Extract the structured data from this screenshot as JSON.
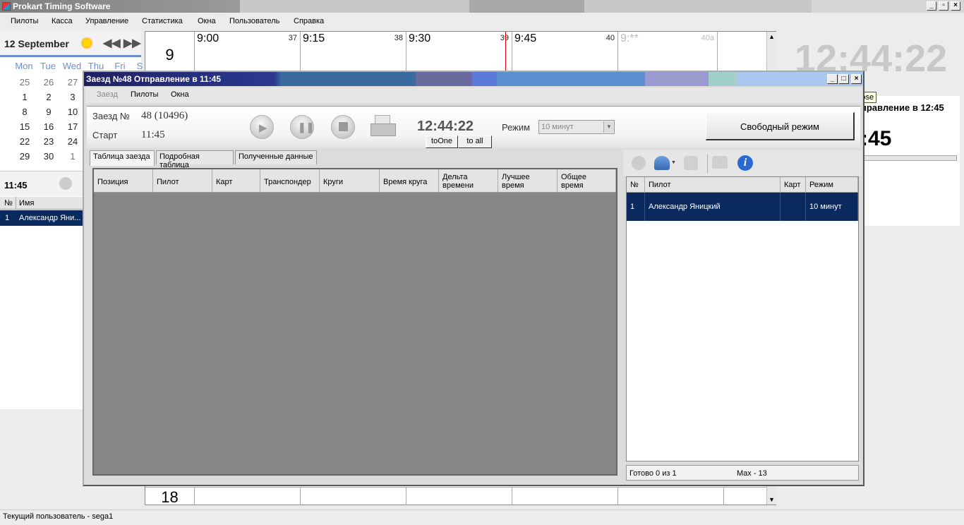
{
  "app": {
    "title": "Prokart Timing Software"
  },
  "menu": [
    "Пилоты",
    "Касса",
    "Управление",
    "Статистика",
    "Окна",
    "Пользователь",
    "Справка"
  ],
  "left": {
    "date": "12 September",
    "weekdays": [
      "Mon",
      "Tue",
      "Wed",
      "Thu",
      "Fri",
      "S"
    ],
    "weeks": [
      [
        "25",
        "26",
        "27"
      ],
      [
        "1",
        "2",
        "3"
      ],
      [
        "8",
        "9",
        "10"
      ],
      [
        "15",
        "16",
        "17"
      ],
      [
        "22",
        "23",
        "24"
      ],
      [
        "29",
        "30",
        "1"
      ]
    ],
    "heat_time": "11:45",
    "col_num": "№",
    "col_name": "Имя",
    "row_num": "1",
    "row_name": "Александр Яни..."
  },
  "schedule": {
    "hour": "9",
    "slots": [
      {
        "time": "9:00",
        "num": "37"
      },
      {
        "time": "9:15",
        "num": "38"
      },
      {
        "time": "9:30",
        "num": "39"
      },
      {
        "time": "9:45",
        "num": "40"
      },
      {
        "time": "9:**",
        "num": "40a"
      }
    ],
    "bottom_hour": "18"
  },
  "right": {
    "clock": "12:44:22",
    "depart": "правление в 12:45",
    "time": ":45"
  },
  "tooltip": "Close",
  "dialog": {
    "title": "Заезд №48 Отправление в 11:45",
    "menu": [
      "Заезд",
      "Пилоты",
      "Окна"
    ],
    "heat_label": "Заезд №",
    "heat_value": "48  (10496)",
    "start_label": "Старт",
    "start_value": "11:45",
    "clock": "12:44:22",
    "toone": "toOne",
    "toall": "to all",
    "mode_label": "Режим",
    "mode_value": "10 минут",
    "free_mode": "Свободный режим",
    "tabs": [
      "Таблица заезда",
      "Подробная таблица",
      "Полученные данные"
    ],
    "columns": [
      "Позиция",
      "Пилот",
      "Карт",
      "Транспондер",
      "Круги",
      "Время круга",
      "Дельта времени",
      "Лучшее время",
      "Общее время"
    ],
    "right_columns": [
      "№",
      "Пилот",
      "Карт",
      "Режим"
    ],
    "right_row": {
      "num": "1",
      "pilot": "Александр Яницкий",
      "kart": "",
      "mode": "10 минут"
    },
    "ready": "Готово 0 из 1",
    "max": "Max - 13"
  },
  "status": {
    "user": "Текущий пользователь - sega1"
  }
}
